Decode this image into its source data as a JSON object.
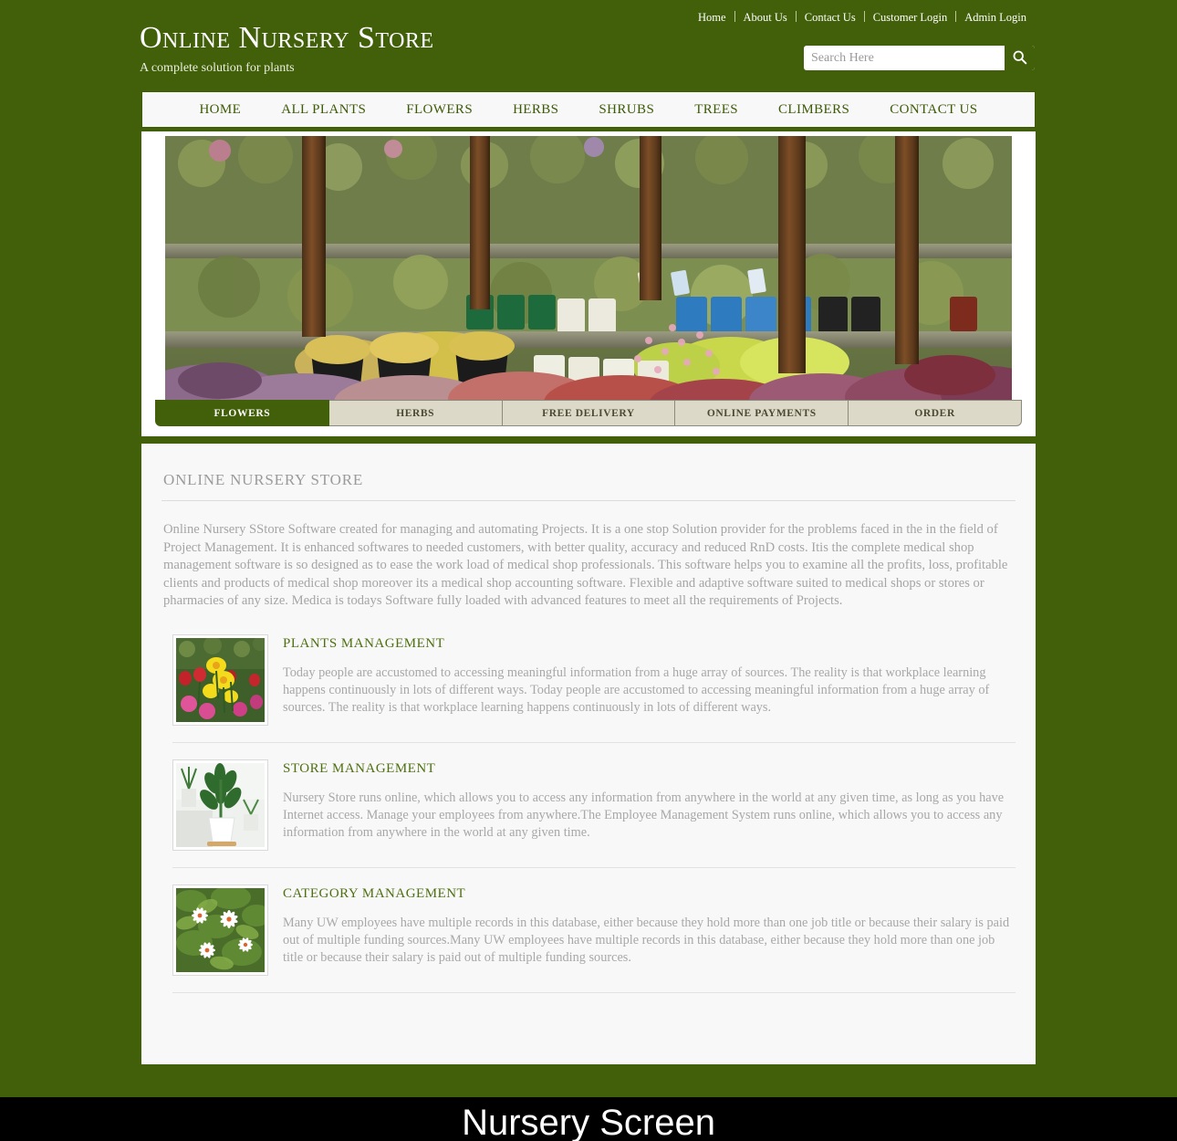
{
  "site": {
    "brand_title": "Online Nursery Store",
    "brand_tagline": "A complete solution for plants"
  },
  "topnav": {
    "items": [
      {
        "label": "Home"
      },
      {
        "label": "About Us"
      },
      {
        "label": "Contact Us"
      },
      {
        "label": "Customer Login"
      },
      {
        "label": "Admin Login"
      }
    ]
  },
  "search": {
    "placeholder": "Search Here",
    "value": "",
    "icon": "search-icon"
  },
  "mainnav": {
    "items": [
      {
        "label": "HOME"
      },
      {
        "label": "ALL PLANTS"
      },
      {
        "label": "FLOWERS"
      },
      {
        "label": "HERBS"
      },
      {
        "label": "SHRUBS"
      },
      {
        "label": "TREES"
      },
      {
        "label": "CLIMBERS"
      },
      {
        "label": "CONTACT US"
      }
    ]
  },
  "banner": {
    "alt": "garden centre shelves with potted plants"
  },
  "tabs": {
    "items": [
      {
        "label": "FLOWERS",
        "active": true
      },
      {
        "label": "HERBS",
        "active": false
      },
      {
        "label": "FREE DELIVERY",
        "active": false
      },
      {
        "label": "ONLINE PAYMENTS",
        "active": false
      },
      {
        "label": "ORDER",
        "active": false
      }
    ]
  },
  "main": {
    "section_title": "ONLINE NURSERY STORE",
    "intro": "Online Nursery SStore Software created for managing and automating Projects. It is a one stop Solution provider for the problems faced in the in the field of Project Management. It is enhanced softwares to needed customers, with better quality, accuracy and reduced RnD costs. Itis the complete medical shop management software is so designed as to ease the work load of medical shop professionals. This software helps you to examine all the profits, loss, profitable clients and products of medical shop moreover its a medical shop accounting software. Flexible and adaptive software suited to medical shops or stores or pharmacies of any size. Medica is todays Software fully loaded with advanced features to meet all the requirements of Projects.",
    "features": [
      {
        "title": "PLANTS MANAGEMENT",
        "text": "Today people are accustomed to accessing meaningful information from a huge array of sources. The reality is that workplace learning happens continuously in lots of different ways. Today people are accustomed to accessing meaningful information from a huge array of sources. The reality is that workplace learning happens continuously in lots of different ways.",
        "thumb": "tulips-daffodils-thumbnail"
      },
      {
        "title": "STORE MANAGEMENT",
        "text": "Nursery Store runs online, which allows you to access any information from anywhere in the world at any given time, as long as you have Internet access. Manage your employees from anywhere.The Employee Management System runs online, which allows you to access any information from anywhere in the world at any given time.",
        "thumb": "potted-houseplant-thumbnail"
      },
      {
        "title": "CATEGORY MANAGEMENT",
        "text": "Many UW employees have multiple records in this database, either because they hold more than one job title or because their salary is paid out of multiple funding sources.Many UW employees have multiple records in this database, either because they hold more than one job title or because their salary is paid out of multiple funding sources.",
        "thumb": "white-jasmine-flowers-thumbnail"
      }
    ]
  },
  "footer": {
    "caption": "Nursery Screen"
  },
  "colors": {
    "brand_green": "#42600a",
    "nav_text": "#3d5a07",
    "panel_bg": "#f8f8f8",
    "tab_inactive": "#ddd9c9",
    "body_text": "#a5a5a5",
    "feature_heading": "#4e7010",
    "footer_bar": "#000000"
  }
}
